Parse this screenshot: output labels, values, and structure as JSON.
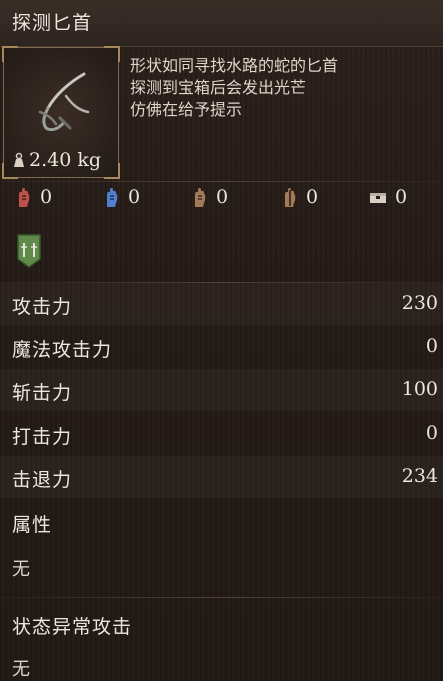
{
  "item": {
    "name": "探测匕首",
    "weight": "2.40 kg",
    "description": [
      "形状如同寻找水路的蛇的匕首",
      "探测到宝箱后会发出光芒",
      "仿佛在给予提示"
    ]
  },
  "resistances": [
    {
      "icon": "red-hand-icon",
      "value": "0",
      "color": "#c2504a"
    },
    {
      "icon": "blue-hand-icon",
      "value": "0",
      "color": "#4f7fd0"
    },
    {
      "icon": "brown-hand-icon",
      "value": "0",
      "color": "#a37a58"
    },
    {
      "icon": "split-hand-icon",
      "value": "0",
      "color": "#a37a58"
    },
    {
      "icon": "chest-icon",
      "value": "0",
      "color": "#d8d0c4"
    }
  ],
  "badge": {
    "icon": "green-shield-icon",
    "color": "#5f8a4a"
  },
  "stats": [
    {
      "label": "攻击力",
      "value": "230"
    },
    {
      "label": "魔法攻击力",
      "value": "0"
    },
    {
      "label": "斩击力",
      "value": "100"
    },
    {
      "label": "打击力",
      "value": "0"
    },
    {
      "label": "击退力",
      "value": "234"
    }
  ],
  "attribute": {
    "label": "属性",
    "value": "无"
  },
  "status_attack": {
    "label": "状态异常攻击",
    "value": "无"
  }
}
